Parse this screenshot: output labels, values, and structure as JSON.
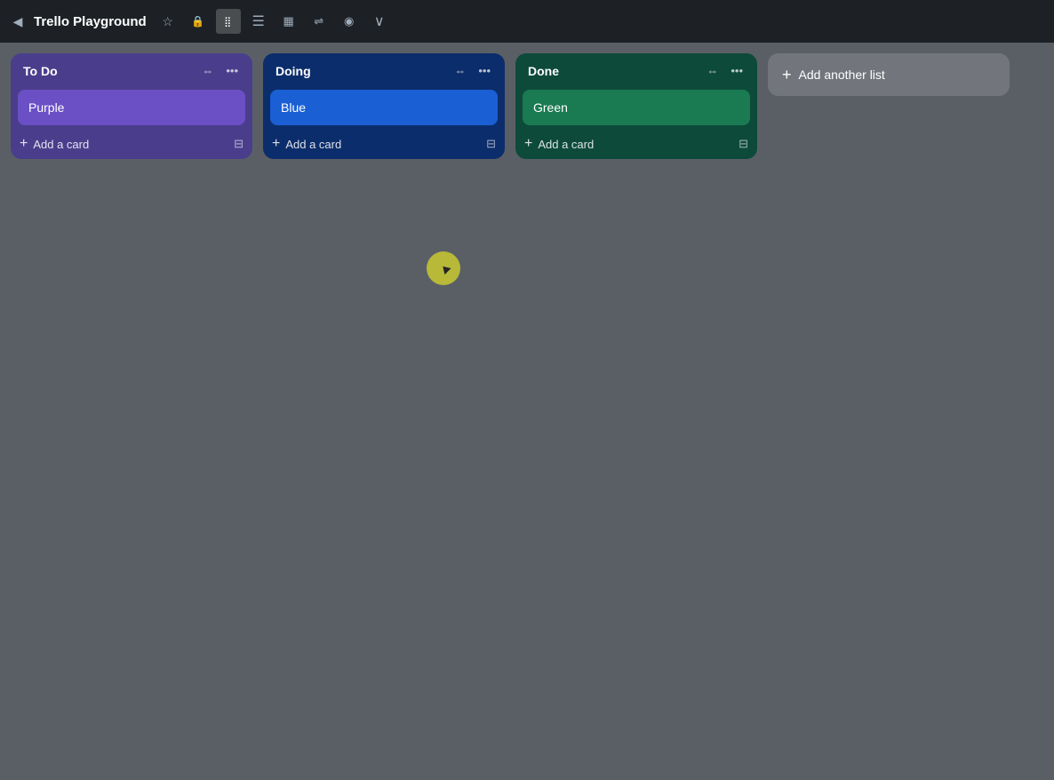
{
  "navbar": {
    "back_icon": "◀",
    "title": "Trello Playground",
    "star_icon": "★",
    "lock_icon": "🔒",
    "board_icon": "⊞",
    "table_icon": "▤",
    "calendar_icon": "📅",
    "workflow_icon": "⇌",
    "map_icon": "📍",
    "overflow_icon": "∨"
  },
  "lists": [
    {
      "id": "todo",
      "title": "To Do",
      "theme": "todo",
      "cards": [
        {
          "label": "Purple",
          "theme": "purple"
        }
      ],
      "add_card_label": "Add a card"
    },
    {
      "id": "doing",
      "title": "Doing",
      "theme": "doing",
      "cards": [
        {
          "label": "Blue",
          "theme": "blue"
        }
      ],
      "add_card_label": "Add a card"
    },
    {
      "id": "done",
      "title": "Done",
      "theme": "done",
      "cards": [
        {
          "label": "Green",
          "theme": "green"
        }
      ],
      "add_card_label": "Add a card"
    }
  ],
  "add_list": {
    "label": "Add another list",
    "plus_icon": "+"
  },
  "icons": {
    "collapse": "⇔",
    "more": "•••",
    "plus": "+",
    "template": "⊟",
    "star": "☆",
    "lock": "🔒",
    "overflow": "∨"
  }
}
